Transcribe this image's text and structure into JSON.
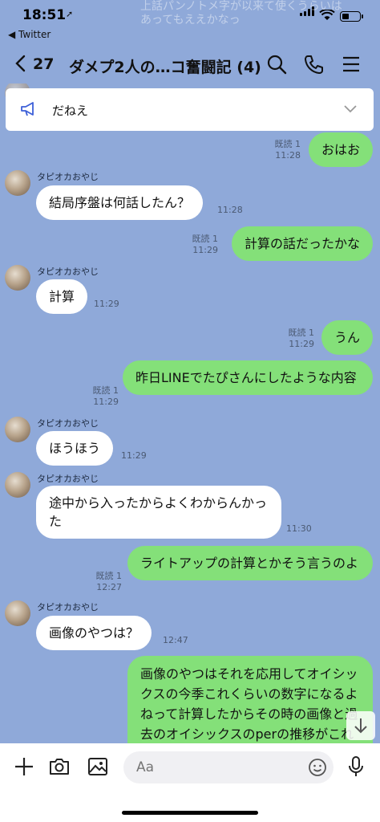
{
  "status": {
    "time": "18:51",
    "back_app": "◀ Twitter"
  },
  "ghost_text": "上話パンノトメ字が以来て使くうらいはあってもええかなっ",
  "header": {
    "back_count": "27",
    "title": "ダメプ2人の…コ奮闘記 (4)"
  },
  "pinned": {
    "text": "だねえ"
  },
  "messages": [
    {
      "dir": "out",
      "text": "おはお",
      "read": "既読 1",
      "time": "11:28"
    },
    {
      "dir": "in",
      "sender": "タピオカおやじ",
      "text": "結局序盤は何話したん？",
      "time": "11:28"
    },
    {
      "dir": "out",
      "text": "計算の話だったかな",
      "read": "既読 1",
      "time": "11:29"
    },
    {
      "dir": "in",
      "sender": "タピオカおやじ",
      "text": "計算",
      "time": "11:29"
    },
    {
      "dir": "out",
      "text": "うん",
      "read": "既読 1",
      "time": "11:29"
    },
    {
      "dir": "out",
      "text": "昨日LINEでたぴさんにしたような内容",
      "read": "既読 1",
      "time": "11:29"
    },
    {
      "dir": "in",
      "sender": "タピオカおやじ",
      "text": "ほうほう",
      "time": "11:29"
    },
    {
      "dir": "in",
      "sender": "タピオカおやじ",
      "text": "途中から入ったからよくわからんかった",
      "time": "11:30"
    },
    {
      "dir": "out",
      "text": "ライトアップの計算とかそう言うのよ",
      "read": "既読 1",
      "time": "12:27"
    },
    {
      "dir": "in",
      "sender": "タピオカおやじ",
      "text": "画像のやつは？",
      "time": "12:47"
    },
    {
      "dir": "out",
      "text": "画像のやつはそれを応用してオイシックスの今季これくらいの数字になるよねって計算したからその時の画像と過去のオイシックスのperの推移がこれくらいだからその数字なら"
    }
  ],
  "input": {
    "placeholder": "Aa"
  }
}
